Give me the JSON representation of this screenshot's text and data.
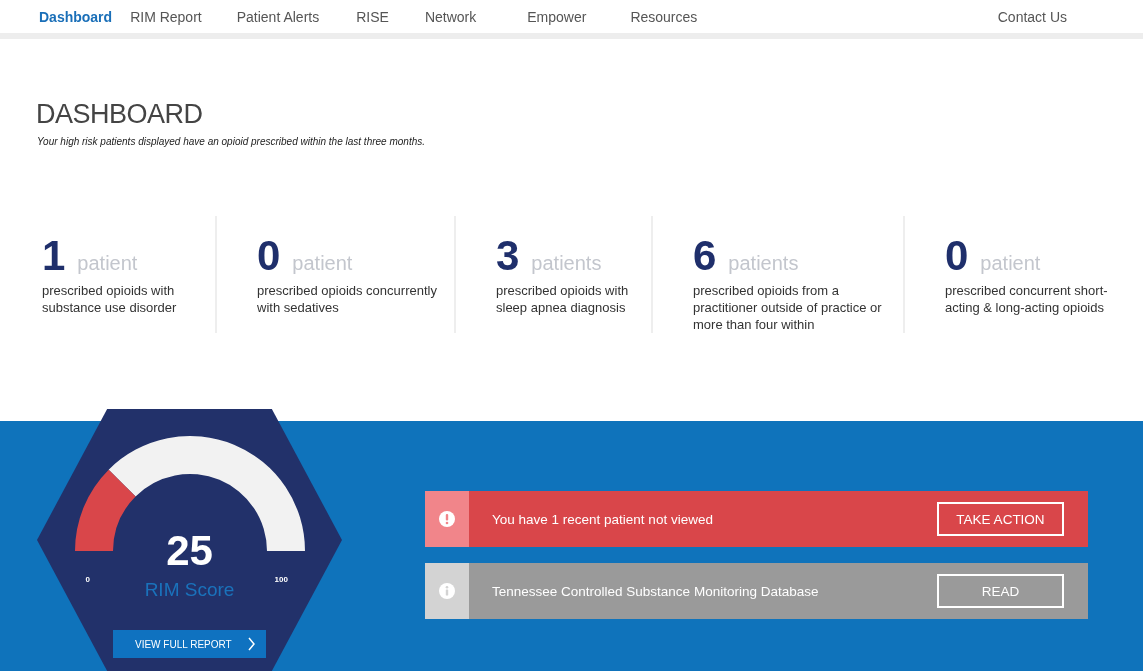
{
  "nav": {
    "items": [
      {
        "label": "Dashboard",
        "selected": true
      },
      {
        "label": "RIM Report",
        "selected": false
      },
      {
        "label": "Patient Alerts",
        "selected": false
      },
      {
        "label": "RISE",
        "selected": false
      },
      {
        "label": "Network",
        "selected": false
      },
      {
        "label": "Empower",
        "selected": false
      },
      {
        "label": "Resources",
        "selected": false
      }
    ],
    "contact": "Contact Us"
  },
  "header": {
    "title": "DASHBOARD",
    "subtitle": "Your high risk patients displayed have an opioid prescribed within the last three months."
  },
  "stats": [
    {
      "count": "1",
      "unit": "patient",
      "description": "prescribed opioids with substance use disorder"
    },
    {
      "count": "0",
      "unit": "patient",
      "description": "prescribed opioids concurrently with sedatives"
    },
    {
      "count": "3",
      "unit": "patients",
      "description": "prescribed opioids with sleep apnea diagnosis"
    },
    {
      "count": "6",
      "unit": "patients",
      "description": "prescribed opioids from a practitioner outside of practice or more than four within"
    },
    {
      "count": "0",
      "unit": "patient",
      "description": "prescribed concurrent short-acting & long-acting opioids"
    }
  ],
  "rim_score": {
    "value": "25",
    "label": "RIM Score",
    "min": "0",
    "max": "100",
    "button": "VIEW FULL REPORT"
  },
  "alerts": [
    {
      "kind": "warning",
      "message": "You have 1 recent patient not viewed",
      "action": "TAKE ACTION"
    },
    {
      "kind": "info",
      "message": "Tennessee Controlled Substance Monitoring Database",
      "action": "READ"
    }
  ]
}
